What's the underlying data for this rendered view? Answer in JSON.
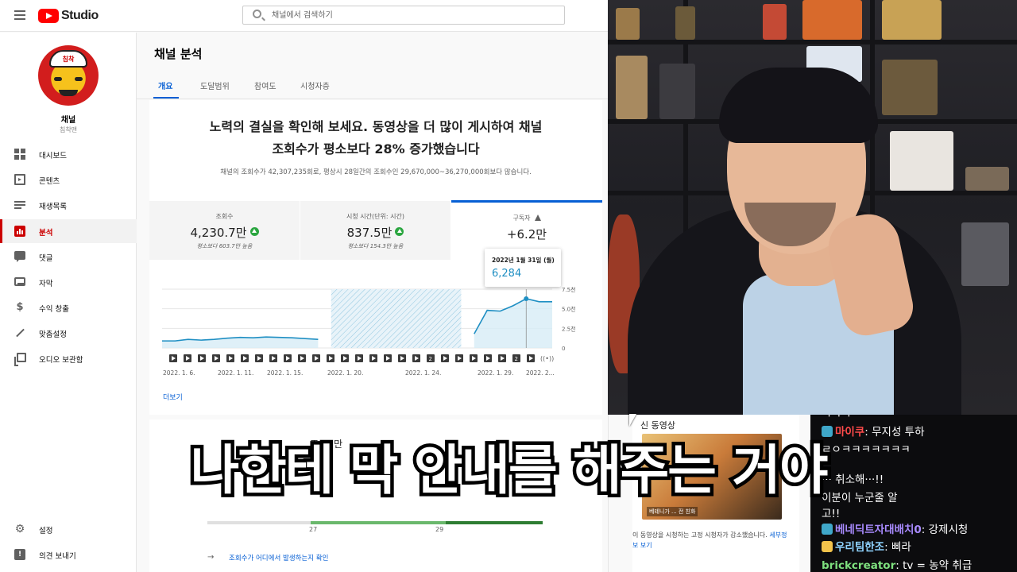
{
  "studio": {
    "logo_text": "Studio",
    "search_placeholder": "채널에서 검색하기",
    "channel": {
      "name": "채널",
      "subtitle": "침착맨",
      "avatar_text": "침착"
    },
    "nav": [
      {
        "label": "대시보드",
        "icon": "dashboard-icon"
      },
      {
        "label": "콘텐츠",
        "icon": "content-icon"
      },
      {
        "label": "재생목록",
        "icon": "playlist-icon"
      },
      {
        "label": "분석",
        "icon": "analytics-icon",
        "active": true
      },
      {
        "label": "댓글",
        "icon": "comments-icon"
      },
      {
        "label": "자막",
        "icon": "subtitles-icon"
      },
      {
        "label": "수익 창출",
        "icon": "dollar-icon"
      },
      {
        "label": "맞춤설정",
        "icon": "customization-icon"
      },
      {
        "label": "오디오 보관함",
        "icon": "audio-library-icon"
      }
    ],
    "nav_bottom": [
      {
        "label": "설정",
        "icon": "gear-icon"
      },
      {
        "label": "의견 보내기",
        "icon": "feedback-icon"
      }
    ],
    "page_title": "채널 분석",
    "tabs": [
      "개요",
      "도달범위",
      "참여도",
      "시청자층"
    ],
    "active_tab": "개요",
    "headline_line1": "노력의 결실을 확인해 보세요. 동영상을 더 많이 게시하여 채널",
    "headline_line2": "조회수가 평소보다 28% 증가했습니다",
    "subline": "채널의 조회수가 42,307,235회로, 평상시 28일간의 조회수인 29,670,000~36,270,000회보다 많습니다.",
    "metrics": [
      {
        "label": "조회수",
        "value": "4,230.7만",
        "compare": "평소보다 603.7만 높음",
        "trend": "up"
      },
      {
        "label": "시청 시간(단위: 시간)",
        "value": "837.5만",
        "compare": "평소보다 154.3만 높음",
        "trend": "up"
      },
      {
        "label": "구독자",
        "value": "+6.2만",
        "compare": "",
        "trend": "warning",
        "selected": true
      }
    ],
    "tooltip": {
      "date": "2022년 1월 31일 (월)",
      "value": "6,284"
    },
    "more_link": "더보기",
    "lower_partial": "조  ...  만",
    "lower_ticks": [
      "27",
      "29"
    ],
    "where_link": "조회수가 어디에서 발생하는지 확인",
    "latest": {
      "title": "신 동영상",
      "thumb_caption": "베테니가 ... 전 친화",
      "desc": "이 동영상을 시청하는 고정 시청자가 감소했습니다.",
      "detail_link": "세부정보 보기"
    },
    "accent_color": "#065fd4",
    "chart_data": {
      "type": "line",
      "x_ticks": [
        "2022. 1. 6.",
        "2022. 1. 11.",
        "2022. 1. 15.",
        "2022. 1. 20.",
        "2022. 1. 24.",
        "2022. 1. 29.",
        "2022. 2..."
      ],
      "y_ticks": [
        "7.5천",
        "5.0천",
        "2.5천",
        "0"
      ],
      "ylim": [
        0,
        7500
      ],
      "values": [
        900,
        900,
        1100,
        1000,
        1100,
        1250,
        1350,
        1300,
        1400,
        1350,
        1300,
        1200,
        1100,
        null,
        null,
        null,
        null,
        null,
        null,
        null,
        null,
        null,
        null,
        null,
        1800,
        4800,
        4700,
        5400,
        6284,
        5900,
        5900
      ],
      "no_data_range": [
        13,
        23
      ],
      "highlight_index": 28,
      "marker_labels": [
        "",
        "",
        "",
        "",
        "",
        "",
        "",
        "",
        "",
        "",
        "",
        "",
        "",
        "",
        "",
        "",
        "",
        "",
        "",
        "",
        "",
        "",
        "",
        "",
        "2",
        "",
        "",
        "",
        "",
        "",
        "2",
        "",
        "",
        "",
        "",
        "",
        "",
        "",
        "",
        "",
        "",
        "",
        "",
        "",
        "",
        "",
        "",
        "",
        "",
        "",
        "",
        "",
        "",
        "",
        "",
        "",
        "",
        "",
        "",
        "",
        "",
        "",
        "",
        "",
        "",
        "",
        "",
        "",
        "",
        "",
        "",
        "",
        "",
        "",
        "",
        "2"
      ],
      "line_color": "#1f8fc3"
    }
  },
  "chat": [
    {
      "user": "",
      "text": "ㅋㅋㅋ",
      "user_color": "#ffffff",
      "badge_color": ""
    },
    {
      "user": "마이쿠",
      "text": ": 무지성 투하",
      "user_color": "#ff4b4b",
      "badge_color": "#3fa7c9"
    },
    {
      "user": "",
      "text": "ㄹㅇㅋㅋㅋㅋㅋㅋㅋ",
      "user_color": "#ffffff",
      "badge_color": ""
    },
    {
      "user": "",
      "text": "··· 취소해···!!",
      "user_color": "#ffffff",
      "badge_color": ""
    },
    {
      "user": "",
      "text": "이분이 누군줄 알",
      "user_color": "#ffffff",
      "badge_color": ""
    },
    {
      "user": "",
      "text": "고!!",
      "user_color": "#ffffff",
      "badge_color": ""
    },
    {
      "user": "베네딕트자대배치0",
      "text": ": 강제시청",
      "user_color": "#a98bff",
      "badge_color": "#3fa7c9"
    },
    {
      "user": "우리팀한조",
      "text": ": 삐라",
      "user_color": "#8fd3ff",
      "badge_color": "#f3c34b"
    },
    {
      "user": "brickcreator",
      "text": ": tv = 농약 취급",
      "user_color": "#7ee07e",
      "badge_color": ""
    }
  ],
  "subtitle": "나한테 막 안내를 해주는 거야"
}
